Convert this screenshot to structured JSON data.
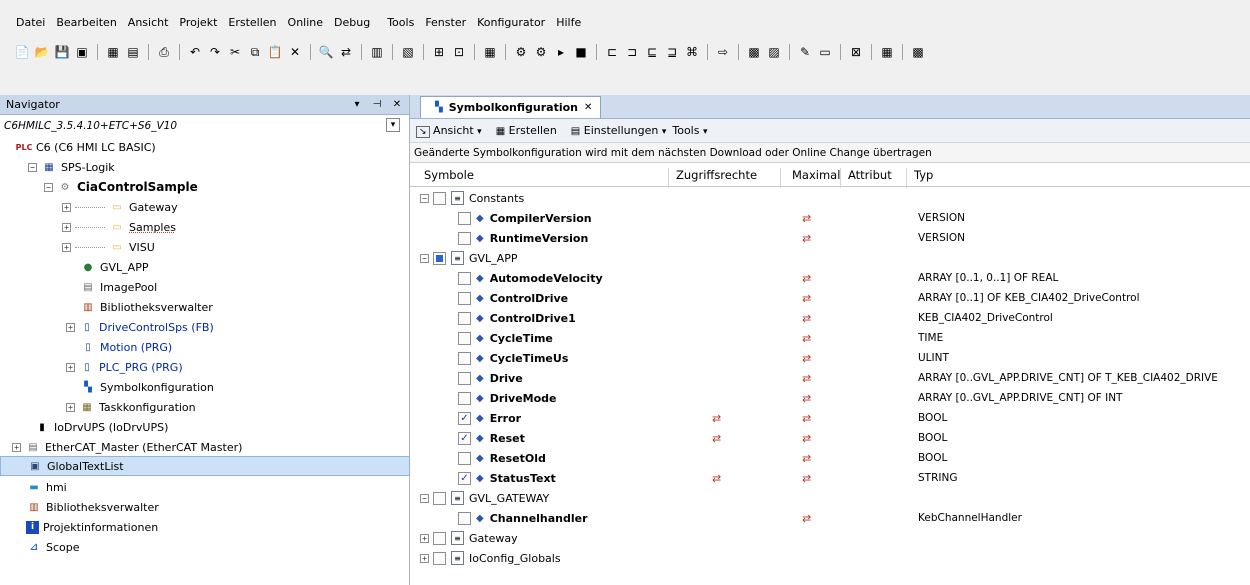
{
  "menu": [
    "Datei",
    "Bearbeiten",
    "Ansicht",
    "Projekt",
    "Erstellen",
    "Online",
    "Debug",
    "Tools",
    "Fenster",
    "Konfigurator",
    "Hilfe"
  ],
  "navigator": {
    "title": "Navigator",
    "pin": "▾ ⊣ ✕",
    "items": [
      {
        "label": "C6HMILC_3.5.4.10+ETC+S6_V10",
        "icon": "project-icon"
      },
      {
        "label": "C6 (C6 HMI LC BASIC)",
        "icon": "plc-icon"
      },
      {
        "label": "SPS-Logik",
        "icon": "logic-icon"
      },
      {
        "label": "CiaControlSample",
        "icon": "application-icon"
      },
      {
        "label": "Gateway",
        "icon": "folder-icon"
      },
      {
        "label": "Samples",
        "icon": "folder-icon"
      },
      {
        "label": "VISU",
        "icon": "folder-icon"
      },
      {
        "label": "GVL_APP",
        "icon": "globe-icon"
      },
      {
        "label": "ImagePool",
        "icon": "imagepool-icon"
      },
      {
        "label": "Bibliotheksverwalter",
        "icon": "library-icon"
      },
      {
        "label": "DriveControlSps (FB)",
        "icon": "fb-icon"
      },
      {
        "label": "Motion (PRG)",
        "icon": "prg-icon"
      },
      {
        "label": "PLC_PRG (PRG)",
        "icon": "prg-icon"
      },
      {
        "label": "Symbolkonfiguration",
        "icon": "symbol-icon"
      },
      {
        "label": "Taskkonfiguration",
        "icon": "task-icon"
      },
      {
        "label": "IoDrvUPS (IoDrvUPS)",
        "icon": "ups-icon"
      },
      {
        "label": "EtherCAT_Master (EtherCAT Master)",
        "icon": "ethercat-icon"
      },
      {
        "label": "GlobalTextList",
        "icon": "textlist-icon"
      },
      {
        "label": "hmi",
        "icon": "hmi-icon"
      },
      {
        "label": "Bibliotheksverwalter",
        "icon": "library-icon"
      },
      {
        "label": "Projektinformationen",
        "icon": "info-icon"
      },
      {
        "label": "Scope",
        "icon": "scope-icon"
      }
    ]
  },
  "editor": {
    "tab_label": "Symbolkonfiguration",
    "toolbar": {
      "ansicht": "Ansicht",
      "erstellen": "Erstellen",
      "einstellungen": "Einstellungen",
      "tools": "Tools"
    },
    "info": "Geänderte Symbolkonfiguration wird mit dem nächsten Download oder Online Change übertragen",
    "columns": {
      "symbole": "Symbole",
      "zugriff": "Zugriffsrechte",
      "maximal": "Maximal",
      "attribut": "Attribut",
      "typ": "Typ"
    },
    "rows": [
      {
        "name": "Constants",
        "kind": "group",
        "type": ""
      },
      {
        "name": "CompilerVersion",
        "kind": "var",
        "checked": false,
        "zugriff": false,
        "type": "VERSION"
      },
      {
        "name": "RuntimeVersion",
        "kind": "var",
        "checked": false,
        "zugriff": false,
        "type": "VERSION"
      },
      {
        "name": "GVL_APP",
        "kind": "group",
        "type": ""
      },
      {
        "name": "AutomodeVelocity",
        "kind": "var",
        "checked": false,
        "zugriff": false,
        "type": "ARRAY [0..1, 0..1] OF REAL"
      },
      {
        "name": "ControlDrive",
        "kind": "var",
        "checked": false,
        "zugriff": false,
        "type": "ARRAY [0..1] OF KEB_CIA402_DriveControl"
      },
      {
        "name": "ControlDrive1",
        "kind": "var",
        "checked": false,
        "zugriff": false,
        "type": "KEB_CIA402_DriveControl"
      },
      {
        "name": "CycleTime",
        "kind": "var",
        "checked": false,
        "zugriff": false,
        "type": "TIME"
      },
      {
        "name": "CycleTimeUs",
        "kind": "var",
        "checked": false,
        "zugriff": false,
        "type": "ULINT"
      },
      {
        "name": "Drive",
        "kind": "var",
        "checked": false,
        "zugriff": false,
        "type": "ARRAY [0..GVL_APP.DRIVE_CNT] OF T_KEB_CIA402_DRIVE"
      },
      {
        "name": "DriveMode",
        "kind": "var",
        "checked": false,
        "zugriff": false,
        "type": "ARRAY [0..GVL_APP.DRIVE_CNT] OF INT"
      },
      {
        "name": "Error",
        "kind": "var",
        "checked": true,
        "zugriff": true,
        "type": "BOOL"
      },
      {
        "name": "Reset",
        "kind": "var",
        "checked": true,
        "zugriff": true,
        "type": "BOOL"
      },
      {
        "name": "ResetOld",
        "kind": "var",
        "checked": false,
        "zugriff": false,
        "type": "BOOL"
      },
      {
        "name": "StatusText",
        "kind": "var",
        "checked": true,
        "zugriff": true,
        "type": "STRING"
      },
      {
        "name": "GVL_GATEWAY",
        "kind": "group",
        "type": ""
      },
      {
        "name": "Channelhandler",
        "kind": "var",
        "checked": false,
        "zugriff": false,
        "type": "KebChannelHandler"
      },
      {
        "name": "Gateway",
        "kind": "group",
        "type": ""
      },
      {
        "name": "IoConfig_Globals",
        "kind": "group",
        "type": ""
      }
    ]
  },
  "colors": {
    "selection": "#cce1f6",
    "link": "#0028a8",
    "panel_header": "#c9d7ea"
  }
}
